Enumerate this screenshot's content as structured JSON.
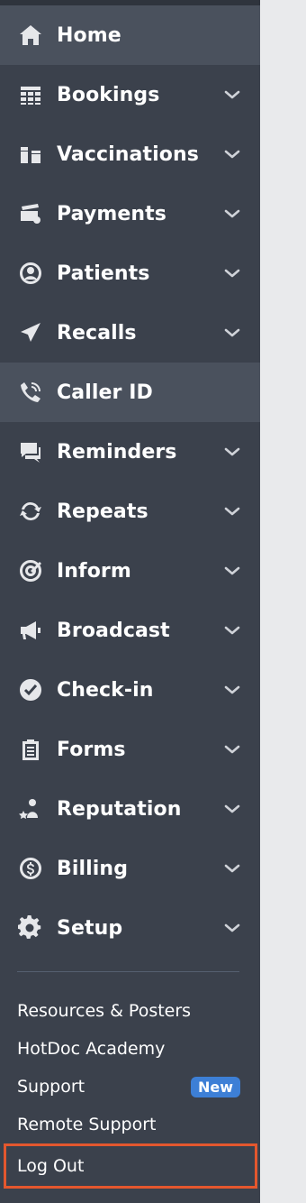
{
  "nav": [
    {
      "label": "Home",
      "icon": "home-icon",
      "active": true,
      "chevron": false
    },
    {
      "label": "Bookings",
      "icon": "table-icon",
      "active": false,
      "chevron": true
    },
    {
      "label": "Vaccinations",
      "icon": "vaccine-icon",
      "active": false,
      "chevron": true
    },
    {
      "label": "Payments",
      "icon": "payment-icon",
      "active": false,
      "chevron": true
    },
    {
      "label": "Patients",
      "icon": "user-circle-icon",
      "active": false,
      "chevron": true
    },
    {
      "label": "Recalls",
      "icon": "paper-plane-icon",
      "active": false,
      "chevron": true
    },
    {
      "label": "Caller ID",
      "icon": "phone-icon",
      "active": true,
      "chevron": false
    },
    {
      "label": "Reminders",
      "icon": "chat-icon",
      "active": false,
      "chevron": true
    },
    {
      "label": "Repeats",
      "icon": "repeat-icon",
      "active": false,
      "chevron": true
    },
    {
      "label": "Inform",
      "icon": "target-icon",
      "active": false,
      "chevron": true
    },
    {
      "label": "Broadcast",
      "icon": "megaphone-icon",
      "active": false,
      "chevron": true
    },
    {
      "label": "Check-in",
      "icon": "check-circle-icon",
      "active": false,
      "chevron": true
    },
    {
      "label": "Forms",
      "icon": "clipboard-icon",
      "active": false,
      "chevron": true
    },
    {
      "label": "Reputation",
      "icon": "star-user-icon",
      "active": false,
      "chevron": true
    },
    {
      "label": "Billing",
      "icon": "dollar-icon",
      "active": false,
      "chevron": true
    },
    {
      "label": "Setup",
      "icon": "gear-icon",
      "active": false,
      "chevron": true
    }
  ],
  "links": {
    "resources": "Resources & Posters",
    "academy": "HotDoc Academy",
    "support": "Support",
    "support_badge": "New",
    "remote_support": "Remote Support",
    "logout": "Log Out"
  },
  "colors": {
    "sidebar_bg": "#3b414c",
    "active_bg": "#4a515d",
    "badge_bg": "#3d7fd6",
    "highlight_border": "#e4572e"
  }
}
